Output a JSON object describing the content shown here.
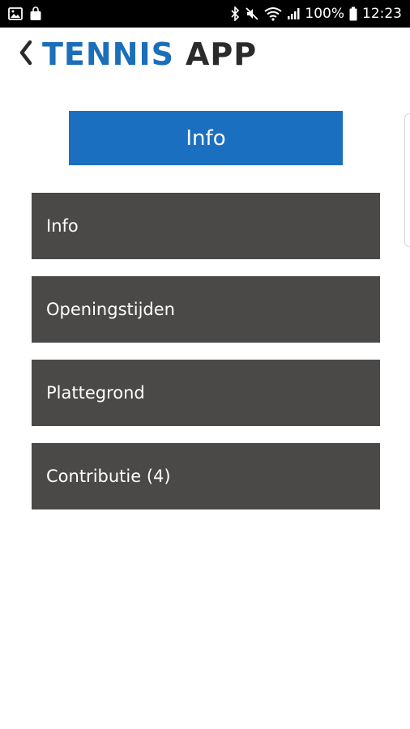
{
  "status_bar": {
    "battery_percent": "100%",
    "time": "12:23",
    "left_icons": [
      "gallery-icon",
      "shopping-bag-icon"
    ],
    "right_icons": [
      "bluetooth-icon",
      "mute-icon",
      "wifi-icon",
      "signal-icon",
      "battery-icon"
    ]
  },
  "header": {
    "brand_part1": "TENNIS",
    "brand_part2": "APP",
    "back_icon": "chevron-left-icon"
  },
  "section": {
    "title": "Info"
  },
  "menu": {
    "items": [
      {
        "label": "Info"
      },
      {
        "label": "Openingstijden"
      },
      {
        "label": "Plattegrond"
      },
      {
        "label": "Contributie (4)"
      }
    ]
  },
  "colors": {
    "accent": "#1a6fc0",
    "brand_blue": "#1a6fb8",
    "menu_bg": "#4a4948"
  }
}
